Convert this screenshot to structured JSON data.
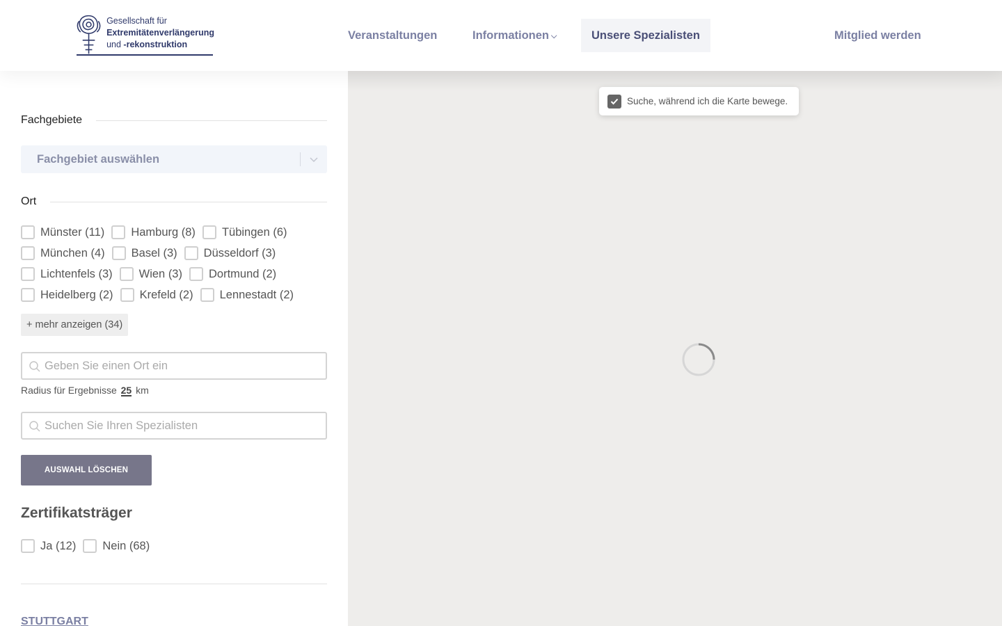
{
  "header": {
    "logo": {
      "line1": "Gesellschaft für",
      "line2": "Extremitätenverlängerung",
      "line3a": "und ",
      "line3b": "-rekonstruktion"
    },
    "nav": {
      "events": "Veranstaltungen",
      "information": "Informationen",
      "specialists": "Unsere Spezialisten",
      "membership": "Mitglied werden"
    }
  },
  "filters": {
    "specialties": {
      "heading": "Fachgebiete",
      "select_placeholder": "Fachgebiet auswählen"
    },
    "location": {
      "heading": "Ort",
      "options": [
        [
          "Münster (11)",
          "Hamburg (8)",
          "Tübingen (6)"
        ],
        [
          "München (4)",
          "Basel (3)",
          "Düsseldorf (3)"
        ],
        [
          "Lichtenfels (3)",
          "Wien (3)",
          "Dortmund (2)"
        ],
        [
          "Heidelberg (2)",
          "Krefeld (2)",
          "Lennestadt (2)"
        ]
      ],
      "show_more": "+ mehr anzeigen (34)",
      "place_placeholder": "Geben Sie einen Ort ein",
      "radius_prefix": "Radius für Ergebnisse",
      "radius_value": "25",
      "radius_unit": "km",
      "specialist_placeholder": "Suchen Sie Ihren Spezialisten",
      "clear_button": "AUSWAHL LÖSCHEN"
    },
    "certificate": {
      "heading": "Zertifikatsträger",
      "yes": "Ja (12)",
      "no": "Nein (68)"
    }
  },
  "results": {
    "first_city": "STUTTGART"
  },
  "map": {
    "search_on_move_label": "Suche, während ich die Karte bewege.",
    "search_on_move_checked": true
  },
  "colors": {
    "nav_text": "#7b80a3",
    "logo_blue": "#303a6b",
    "clear_button_bg": "#77768a",
    "map_bg": "#eeedeb"
  }
}
